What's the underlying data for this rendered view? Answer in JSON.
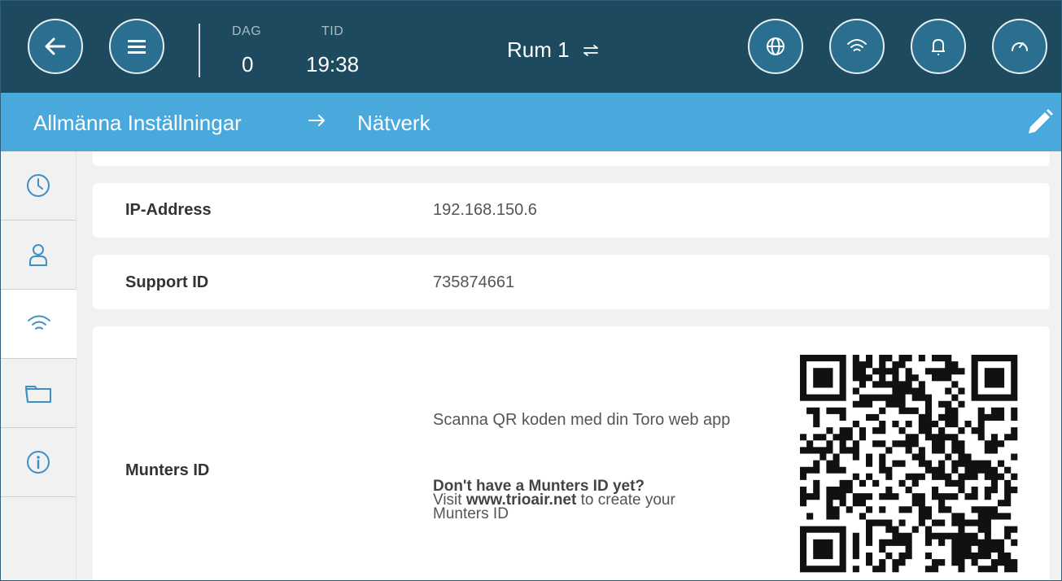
{
  "topbar": {
    "day_label": "DAG",
    "day_value": "0",
    "time_label": "TID",
    "time_value": "19:38",
    "room": "Rum 1",
    "buttons": [
      "back-arrow-icon",
      "hamburger-menu-icon",
      "globe-icon",
      "wifi-icon",
      "bell-icon",
      "speedometer-icon"
    ]
  },
  "breadcrumb": {
    "parent": "Allmänna Inställningar",
    "current": "Nätverk"
  },
  "sidebar": {
    "items": [
      "clock-icon",
      "user-icon",
      "wifi-icon",
      "folder-icon",
      "info-icon"
    ],
    "active_index": 2
  },
  "network": {
    "ip_label": "IP-Address",
    "ip_value": "192.168.150.6",
    "support_label": "Support ID",
    "support_value": "735874661",
    "munters_label": "Munters ID",
    "scan_text": "Scanna QR koden med din Toro web app",
    "note_title": "Don't have a Munters ID yet?",
    "note_visit": "Visit ",
    "note_url": "www.trioair.net",
    "note_rest": " to create your",
    "note_rest2": "Munters ID"
  },
  "colors": {
    "topbar": "#1d4a5e",
    "button": "#2a6f8f",
    "breadcrumb": "#4aa9dc",
    "sidebar_icon": "#3d8fc4"
  }
}
